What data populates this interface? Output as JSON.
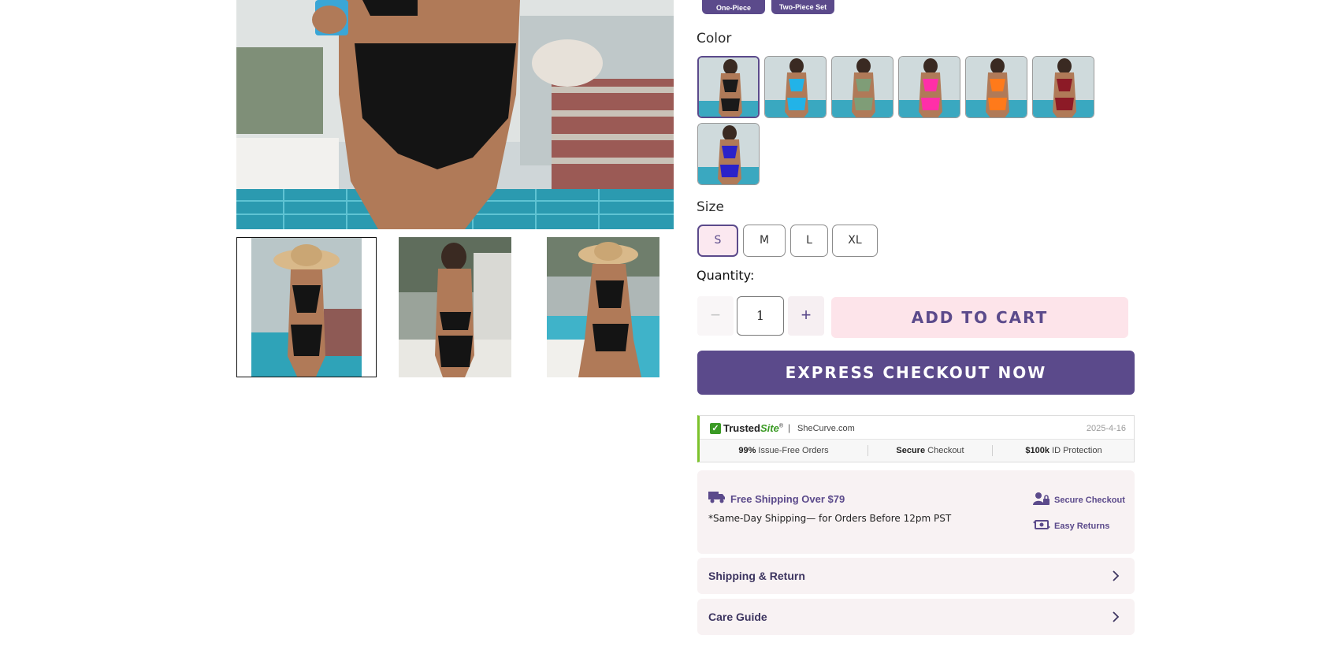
{
  "style_options": [
    {
      "label": "One-Piece"
    },
    {
      "label": "Two-Piece Set"
    }
  ],
  "color": {
    "label": "Color",
    "swatches": [
      {
        "name": "black",
        "suit": "#1a1a1a",
        "selected": true
      },
      {
        "name": "sky blue",
        "suit": "#22b3e8",
        "selected": false
      },
      {
        "name": "sage green",
        "suit": "#7f9d77",
        "selected": false
      },
      {
        "name": "hot pink",
        "suit": "#ff2fa8",
        "selected": false
      },
      {
        "name": "orange",
        "suit": "#ff7a1a",
        "selected": false
      },
      {
        "name": "burgundy",
        "suit": "#8c1a26",
        "selected": false
      },
      {
        "name": "royal blue",
        "suit": "#2a22c9",
        "selected": false
      }
    ]
  },
  "size": {
    "label": "Size",
    "options": [
      "S",
      "M",
      "L",
      "XL"
    ],
    "selected": "S"
  },
  "quantity": {
    "label": "Quantity:",
    "minus": "−",
    "value": "1",
    "plus": "+"
  },
  "buttons": {
    "add_to_cart": "ADD TO CART",
    "express_checkout": "EXPRESS CHECKOUT NOW"
  },
  "trusted_site": {
    "check": "✓",
    "brand_a": "Trusted",
    "brand_b": "Site",
    "brand_tm": "®",
    "separator": "|",
    "domain": "SheCurve.com",
    "date": "2025-4-16",
    "badges": [
      {
        "bold": "99%",
        "rest": " Issue-Free Orders"
      },
      {
        "bold": "Secure",
        "rest": " Checkout"
      },
      {
        "bold": "$100k",
        "rest": " ID Protection"
      }
    ]
  },
  "shipping_info": {
    "title": "Free Shipping Over $79",
    "note": "*Same-Day Shipping— for Orders Before 12pm PST",
    "secure": "Secure Checkout",
    "returns": "Easy Returns"
  },
  "accordions": [
    {
      "title": "Shipping & Return"
    },
    {
      "title": "Care Guide"
    }
  ],
  "colors": {
    "accent": "#5b4a8b",
    "cart_bg": "#fde4ea",
    "panel_bg": "#f8f2f3",
    "trusted_green": "#7cc22c"
  }
}
